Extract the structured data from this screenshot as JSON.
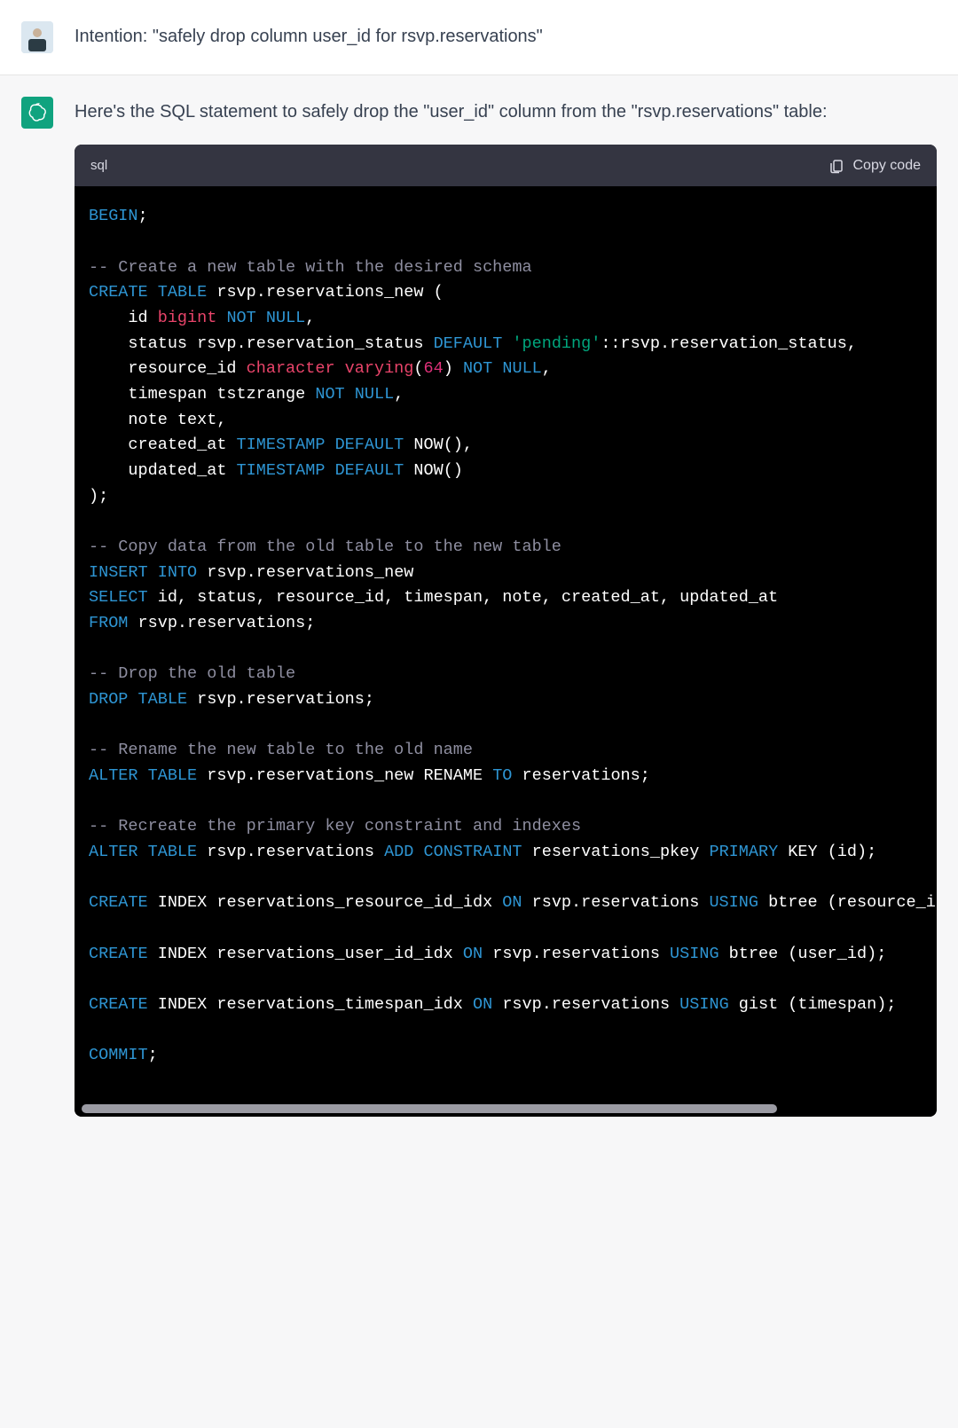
{
  "user_message": "Intention: \"safely drop column user_id for rsvp.reservations\"",
  "assistant_intro": "Here's the SQL statement to safely drop the \"user_id\" column from the \"rsvp.reservations\" table:",
  "code": {
    "language": "sql",
    "copy_label": "Copy code",
    "tokens": [
      [
        "kw",
        "BEGIN"
      ],
      [
        "w",
        ";\n\n"
      ],
      [
        "cm",
        "-- Create a new table with the desired schema"
      ],
      [
        "w",
        "\n"
      ],
      [
        "kw",
        "CREATE"
      ],
      [
        "w",
        " "
      ],
      [
        "kw",
        "TABLE"
      ],
      [
        "w",
        " rsvp.reservations_new (\n    id "
      ],
      [
        "type",
        "bigint"
      ],
      [
        "w",
        " "
      ],
      [
        "kw",
        "NOT"
      ],
      [
        "w",
        " "
      ],
      [
        "kw",
        "NULL"
      ],
      [
        "w",
        ",\n    status rsvp.reservation_status "
      ],
      [
        "kw",
        "DEFAULT"
      ],
      [
        "w",
        " "
      ],
      [
        "str",
        "'pending'"
      ],
      [
        "w",
        "::rsvp.reservation_status,\n    resource_id "
      ],
      [
        "type",
        "character"
      ],
      [
        "w",
        " "
      ],
      [
        "type",
        "varying"
      ],
      [
        "w",
        "("
      ],
      [
        "num",
        "64"
      ],
      [
        "w",
        ") "
      ],
      [
        "kw",
        "NOT"
      ],
      [
        "w",
        " "
      ],
      [
        "kw",
        "NULL"
      ],
      [
        "w",
        ",\n    timespan tstzrange "
      ],
      [
        "kw",
        "NOT"
      ],
      [
        "w",
        " "
      ],
      [
        "kw",
        "NULL"
      ],
      [
        "w",
        ",\n    note text,\n    created_at "
      ],
      [
        "kw",
        "TIMESTAMP"
      ],
      [
        "w",
        " "
      ],
      [
        "kw",
        "DEFAULT"
      ],
      [
        "w",
        " NOW(),\n    updated_at "
      ],
      [
        "kw",
        "TIMESTAMP"
      ],
      [
        "w",
        " "
      ],
      [
        "kw",
        "DEFAULT"
      ],
      [
        "w",
        " NOW()\n);\n\n"
      ],
      [
        "cm",
        "-- Copy data from the old table to the new table"
      ],
      [
        "w",
        "\n"
      ],
      [
        "kw",
        "INSERT"
      ],
      [
        "w",
        " "
      ],
      [
        "kw",
        "INTO"
      ],
      [
        "w",
        " rsvp.reservations_new\n"
      ],
      [
        "kw",
        "SELECT"
      ],
      [
        "w",
        " id, status, resource_id, timespan, note, created_at, updated_at\n"
      ],
      [
        "kw",
        "FROM"
      ],
      [
        "w",
        " rsvp.reservations;\n\n"
      ],
      [
        "cm",
        "-- Drop the old table"
      ],
      [
        "w",
        "\n"
      ],
      [
        "kw",
        "DROP"
      ],
      [
        "w",
        " "
      ],
      [
        "kw",
        "TABLE"
      ],
      [
        "w",
        " rsvp.reservations;\n\n"
      ],
      [
        "cm",
        "-- Rename the new table to the old name"
      ],
      [
        "w",
        "\n"
      ],
      [
        "kw",
        "ALTER"
      ],
      [
        "w",
        " "
      ],
      [
        "kw",
        "TABLE"
      ],
      [
        "w",
        " rsvp.reservations_new RENAME "
      ],
      [
        "kw",
        "TO"
      ],
      [
        "w",
        " reservations;\n\n"
      ],
      [
        "cm",
        "-- Recreate the primary key constraint and indexes"
      ],
      [
        "w",
        "\n"
      ],
      [
        "kw",
        "ALTER"
      ],
      [
        "w",
        " "
      ],
      [
        "kw",
        "TABLE"
      ],
      [
        "w",
        " rsvp.reservations "
      ],
      [
        "kw",
        "ADD"
      ],
      [
        "w",
        " "
      ],
      [
        "kw",
        "CONSTRAINT"
      ],
      [
        "w",
        " reservations_pkey "
      ],
      [
        "kw",
        "PRIMARY"
      ],
      [
        "w",
        " KEY (id);\n\n"
      ],
      [
        "kw",
        "CREATE"
      ],
      [
        "w",
        " INDEX reservations_resource_id_idx "
      ],
      [
        "kw",
        "ON"
      ],
      [
        "w",
        " rsvp.reservations "
      ],
      [
        "kw",
        "USING"
      ],
      [
        "w",
        " btree (resource_id);\n\n"
      ],
      [
        "kw",
        "CREATE"
      ],
      [
        "w",
        " INDEX reservations_user_id_idx "
      ],
      [
        "kw",
        "ON"
      ],
      [
        "w",
        " rsvp.reservations "
      ],
      [
        "kw",
        "USING"
      ],
      [
        "w",
        " btree (user_id);\n\n"
      ],
      [
        "kw",
        "CREATE"
      ],
      [
        "w",
        " INDEX reservations_timespan_idx "
      ],
      [
        "kw",
        "ON"
      ],
      [
        "w",
        " rsvp.reservations "
      ],
      [
        "kw",
        "USING"
      ],
      [
        "w",
        " gist (timespan);\n\n"
      ],
      [
        "kw",
        "COMMIT"
      ],
      [
        "w",
        ";"
      ]
    ]
  }
}
